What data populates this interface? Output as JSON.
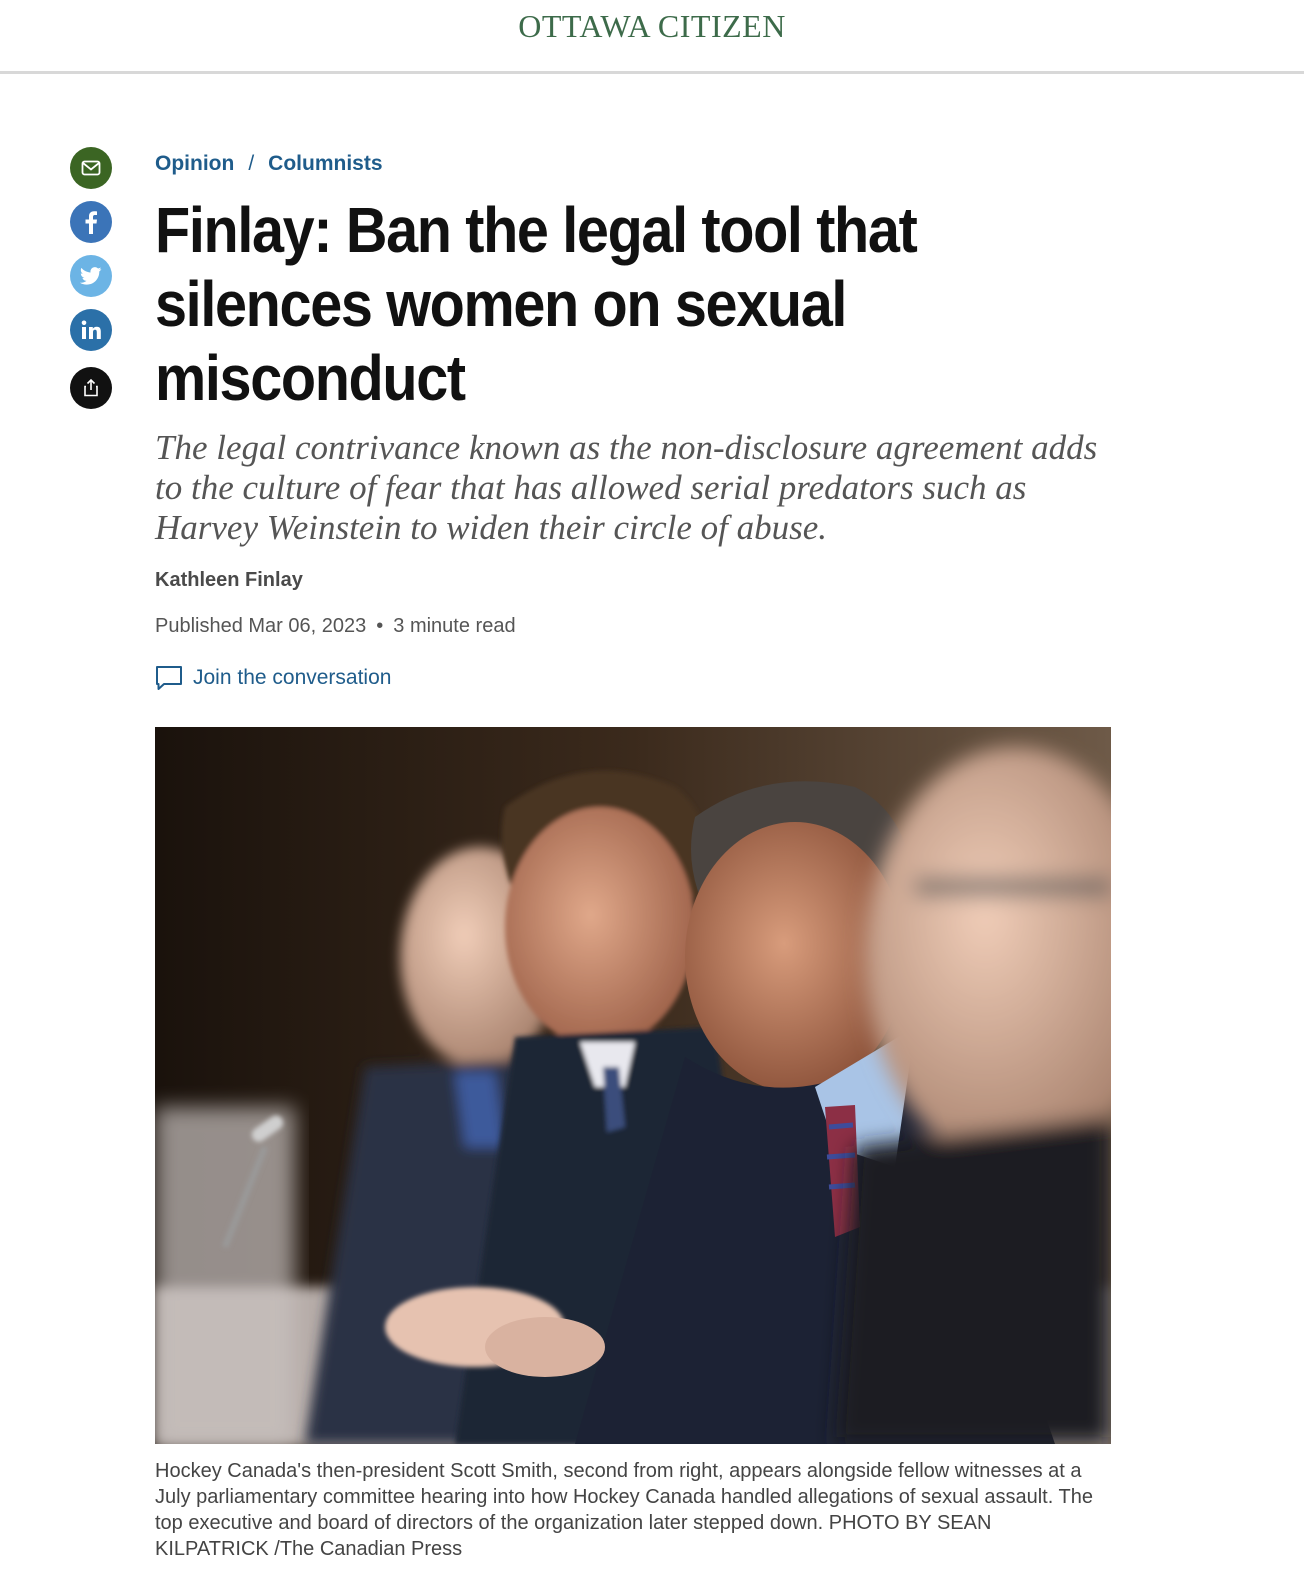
{
  "header": {
    "logo_text": "OTTAWA CITIZEN",
    "brand_color": "#3d6b4a"
  },
  "share_rail": {
    "buttons": [
      {
        "icon": "mail-icon",
        "color": "#3b6523"
      },
      {
        "icon": "facebook-icon",
        "color": "#3b74b8"
      },
      {
        "icon": "twitter-icon",
        "color": "#6cb4e5"
      },
      {
        "icon": "linkedin-icon",
        "color": "#2b70a8"
      },
      {
        "icon": "share-icon",
        "color": "#111111"
      }
    ]
  },
  "breadcrumb": {
    "items": [
      "Opinion",
      "Columnists"
    ],
    "separator": "/"
  },
  "article": {
    "headline": "Finlay: Ban the legal tool that silences women on sexual misconduct",
    "dek": "The legal contrivance known as the non-disclosure agreement adds to the culture of fear that has allowed serial predators such as Harvey Weinstein to widen their circle of abuse.",
    "author": "Kathleen Finlay",
    "published": "Published Mar 06, 2023",
    "read_time": "3 minute read",
    "conversation_label": "Join the conversation"
  },
  "photo": {
    "caption": "Hockey Canada's then-president Scott Smith, second from right, appears alongside fellow witnesses at a July parliamentary committee hearing into how Hockey Canada handled allegations of sexual assault. The top executive and board of directors of the organization later stepped down. PHOTO BY SEAN KILPATRICK /The Canadian Press"
  },
  "colors": {
    "link": "#1f5c8b",
    "headline": "#111111",
    "dek": "#555555"
  }
}
